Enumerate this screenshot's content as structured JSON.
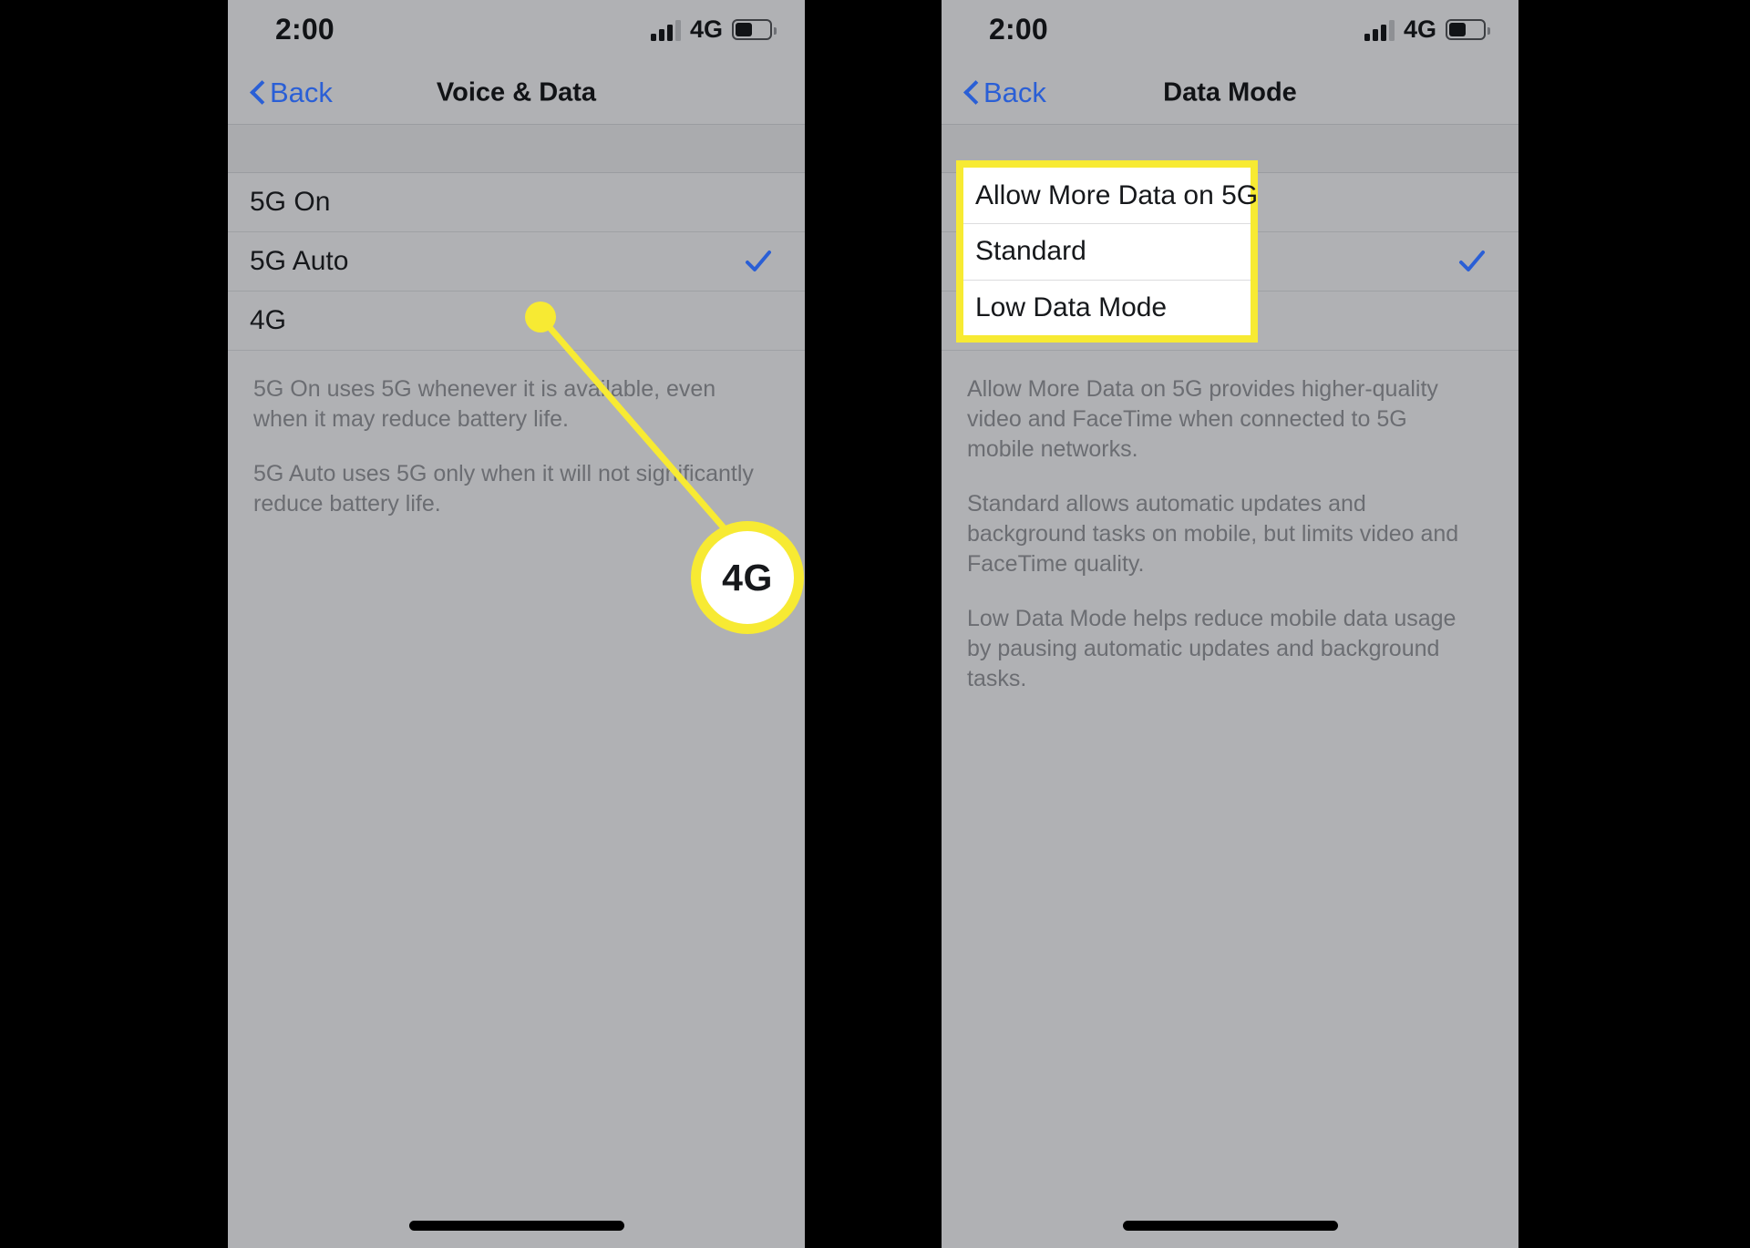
{
  "panels": [
    {
      "status_bar": {
        "time": "2:00",
        "signal_icon": "cellular-signal-icon",
        "carrier": "4G",
        "battery_icon": "battery-icon",
        "battery_level_percent": 45
      },
      "nav": {
        "back_label": "Back",
        "back_icon": "chevron-left-icon",
        "title": "Voice & Data"
      },
      "rows": [
        {
          "label": "5G On",
          "checked": false
        },
        {
          "label": "5G Auto",
          "checked": true
        },
        {
          "label": "4G",
          "checked": false
        }
      ],
      "footer_paragraphs": [
        "5G On uses 5G whenever it is available, even when it may reduce battery life.",
        "5G Auto uses 5G only when it will not significantly reduce battery life."
      ],
      "callout": {
        "label": "4G",
        "color": "#f7ea33"
      }
    },
    {
      "status_bar": {
        "time": "2:00",
        "signal_icon": "cellular-signal-icon",
        "carrier": "4G",
        "battery_icon": "battery-icon",
        "battery_level_percent": 45
      },
      "nav": {
        "back_label": "Back",
        "back_icon": "chevron-left-icon",
        "title": "Data Mode"
      },
      "rows": [
        {
          "label": "Allow More Data on 5G",
          "checked": false
        },
        {
          "label": "Standard",
          "checked": true
        },
        {
          "label": "Low Data Mode",
          "checked": false
        }
      ],
      "footer_paragraphs": [
        "Allow More Data on 5G provides higher-quality video and FaceTime when connected to 5G mobile networks.",
        "Standard allows automatic updates and background tasks on mobile, but limits video and FaceTime quality.",
        "Low Data Mode helps reduce mobile data usage by pausing automatic updates and background tasks."
      ],
      "highlight": {
        "color": "#f7ea33",
        "rows": [
          "Allow More Data on 5G",
          "Standard",
          "Low Data Mode"
        ]
      }
    }
  ],
  "colors": {
    "background": "#000000",
    "screen_background": "#b0b1b4",
    "accent_blue": "#2a5fd6",
    "annotation_yellow": "#f7ea33",
    "text_primary": "#16181b",
    "text_secondary": "#6b6d72"
  }
}
